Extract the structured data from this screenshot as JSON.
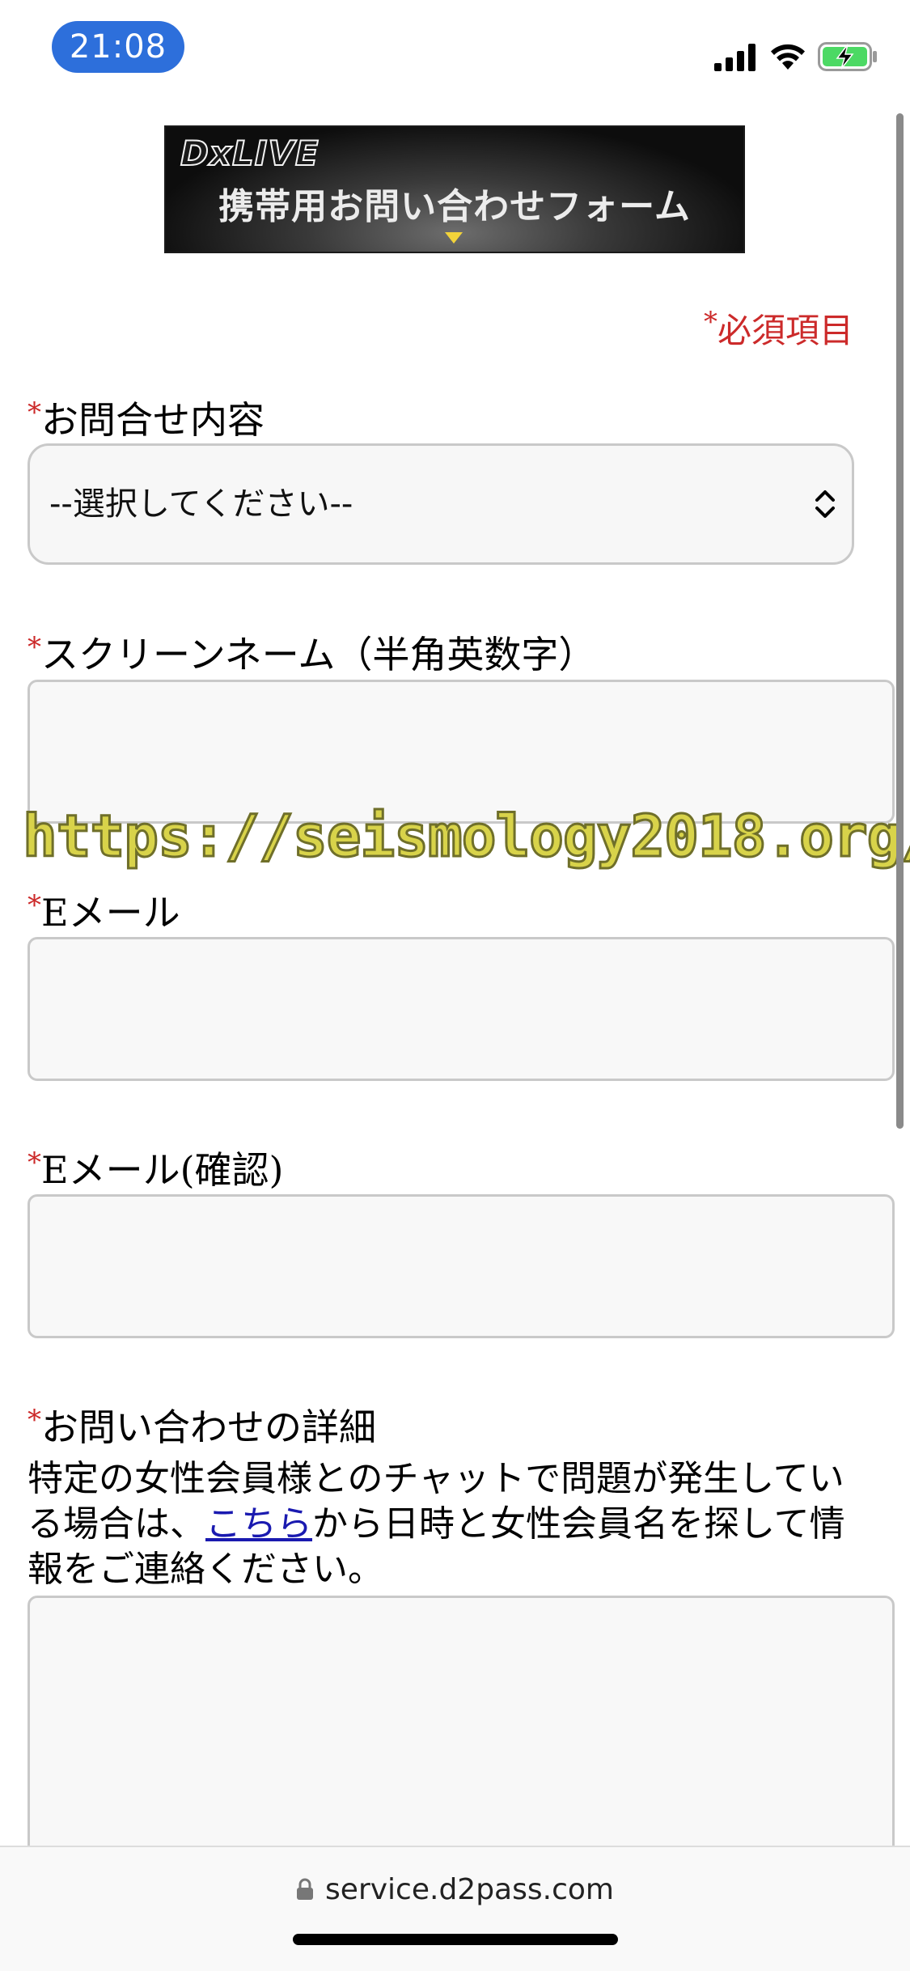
{
  "status_bar": {
    "time": "21:08",
    "icons": [
      "cellular-signal-icon",
      "wifi-icon",
      "battery-charging-icon"
    ],
    "time_pill_color": "#2d6fdb"
  },
  "banner": {
    "brand": "DxLIVE",
    "title": "携帯用お問い合わせフォーム"
  },
  "form": {
    "required_star": "*",
    "required_note": "必須項目",
    "inquiry_type": {
      "label": "お問合せ内容",
      "selected": "--選択してください--"
    },
    "screen_name": {
      "label": "スクリーンネーム（半角英数字）",
      "value": ""
    },
    "email": {
      "label": "Eメール",
      "value": ""
    },
    "email_confirm": {
      "label": "Eメール(確認)",
      "value": ""
    },
    "details": {
      "label": "お問い合わせの詳細",
      "help_before": "特定の女性会員様とのチャットで問題が発生している場合は、",
      "help_link": "こちら",
      "help_after": "から日時と女性会員名を探して情報をご連絡ください。",
      "value": ""
    },
    "accent_color": "#cc2a2a",
    "link_color": "#1a1ab0"
  },
  "watermark": "https://seismology2018.org/",
  "browser": {
    "url": "service.d2pass.com"
  }
}
